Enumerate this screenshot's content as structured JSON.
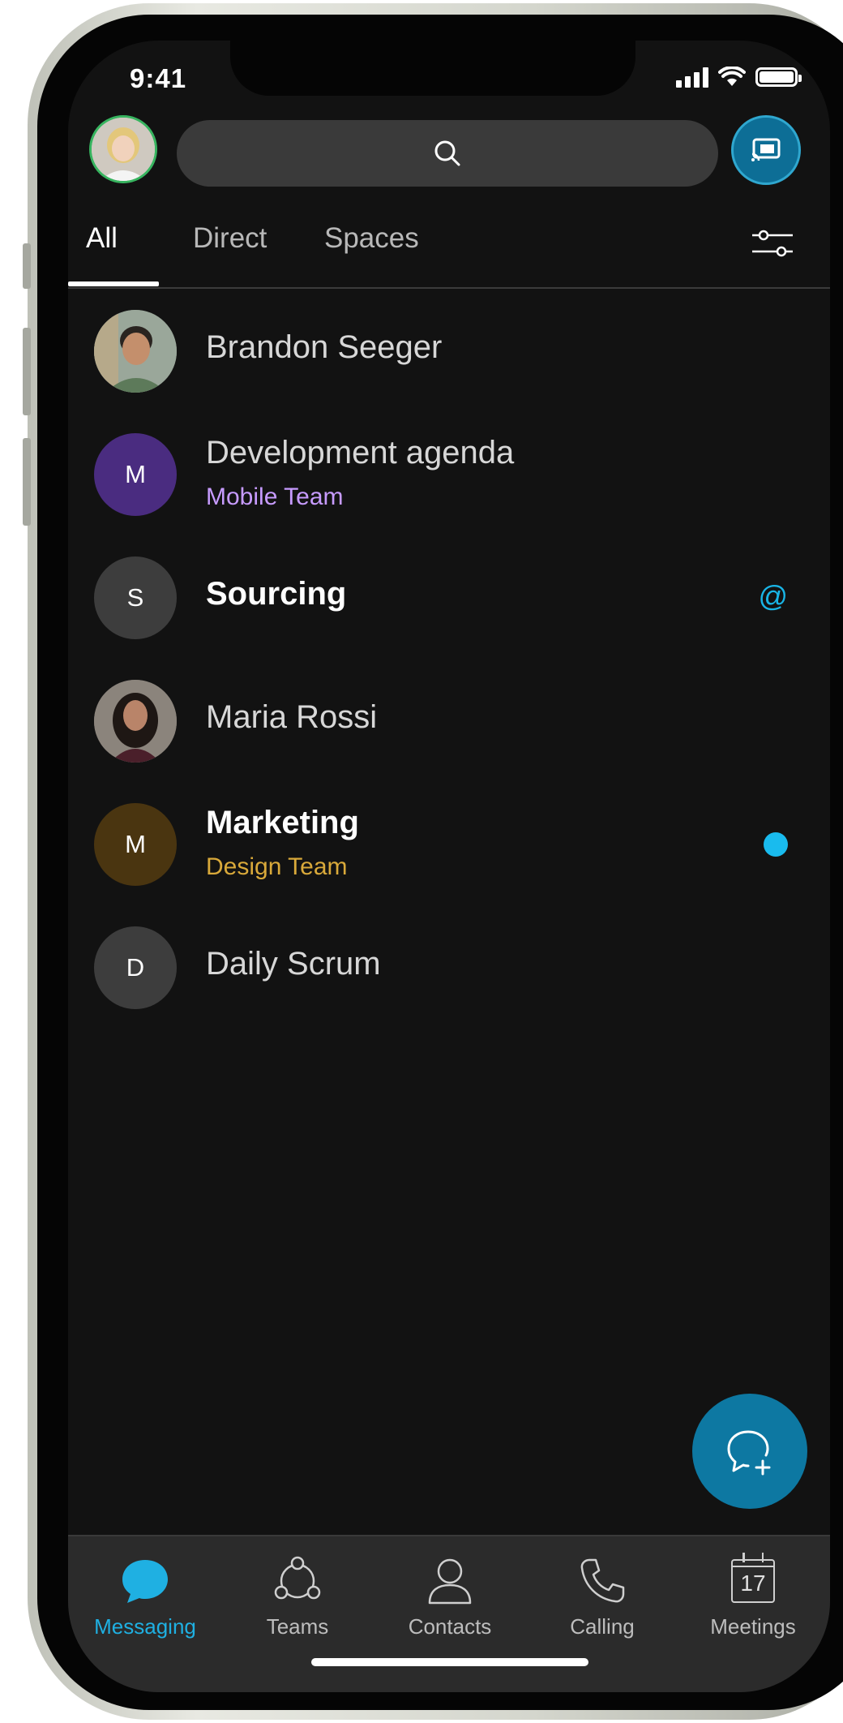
{
  "status_bar": {
    "time": "9:41"
  },
  "header": {
    "search_icon": "search-icon",
    "cast_icon": "screen-share-icon",
    "profile_status_color": "#37b45f"
  },
  "tabs": [
    {
      "label": "All",
      "active": true
    },
    {
      "label": "Direct",
      "active": false
    },
    {
      "label": "Spaces",
      "active": false
    }
  ],
  "conversations": [
    {
      "title": "Brandon Seeger",
      "subtitle": "",
      "avatar": "photo",
      "bold": false,
      "badge": ""
    },
    {
      "title": "Development agenda",
      "subtitle": "Mobile Team",
      "subtitle_color": "#c79bff",
      "avatar": "M",
      "avatar_color": "#4a2c80",
      "bold": false,
      "badge": ""
    },
    {
      "title": "Sourcing",
      "subtitle": "",
      "avatar": "S",
      "avatar_color": "#3d3d3d",
      "bold": true,
      "badge": "@"
    },
    {
      "title": "Maria Rossi",
      "subtitle": "",
      "avatar": "photo",
      "bold": false,
      "badge": ""
    },
    {
      "title": "Marketing",
      "subtitle": "Design Team",
      "subtitle_color": "#d9a93a",
      "avatar": "M",
      "avatar_color": "#4a3510",
      "bold": true,
      "badge": "unread-dot"
    },
    {
      "title": "Daily Scrum",
      "subtitle": "",
      "avatar": "D",
      "avatar_color": "#3d3d3d",
      "bold": false,
      "badge": ""
    }
  ],
  "fab": {
    "icon": "new-message-icon"
  },
  "bottom_nav": [
    {
      "label": "Messaging",
      "icon": "chat-bubble-icon",
      "active": true
    },
    {
      "label": "Teams",
      "icon": "teams-icon",
      "active": false
    },
    {
      "label": "Contacts",
      "icon": "person-icon",
      "active": false
    },
    {
      "label": "Calling",
      "icon": "phone-icon",
      "active": false
    },
    {
      "label": "Meetings",
      "icon": "calendar-icon",
      "active": false,
      "icon_text": "17"
    }
  ],
  "colors": {
    "accent": "#1fb0e2",
    "fab": "#0d78a2",
    "background": "#121212"
  }
}
